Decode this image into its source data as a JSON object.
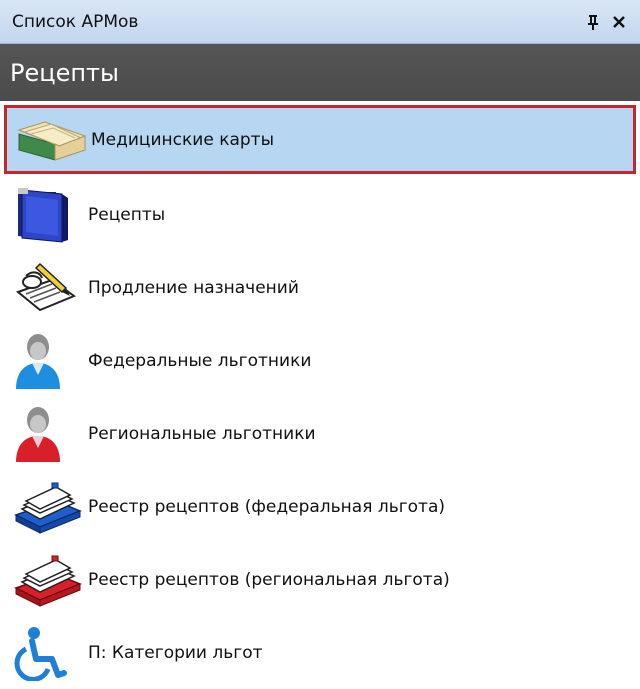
{
  "window": {
    "title": "Список АРМов",
    "pin_glyph": "ᛒ",
    "close_glyph": "✕"
  },
  "group": {
    "title": "Рецепты"
  },
  "items": [
    {
      "label": "Медицинские карты",
      "icon": "medical-cards-icon",
      "selected": true
    },
    {
      "label": "Рецепты",
      "icon": "prescriptions-folder-icon",
      "selected": false
    },
    {
      "label": "Продление назначений",
      "icon": "signing-document-icon",
      "selected": false
    },
    {
      "label": "Федеральные льготники",
      "icon": "federal-beneficiary-person-icon",
      "selected": false
    },
    {
      "label": "Региональные льготники",
      "icon": "regional-beneficiary-person-icon",
      "selected": false
    },
    {
      "label": "Реестр рецептов (федеральная льгота)",
      "icon": "federal-registry-cardfile-icon",
      "selected": false
    },
    {
      "label": "Реестр рецептов (региональная льгота)",
      "icon": "regional-registry-cardfile-icon",
      "selected": false
    },
    {
      "label": "П: Категории льгот",
      "icon": "wheelchair-icon",
      "selected": false
    }
  ],
  "colors": {
    "selection_bg": "#b7d6f2",
    "selection_border": "#c1272d",
    "header_bg": "#4f4f4f",
    "titlebar_bg": "#c9daf0",
    "federal_blue": "#1e6fd9",
    "regional_red": "#d9202a"
  }
}
